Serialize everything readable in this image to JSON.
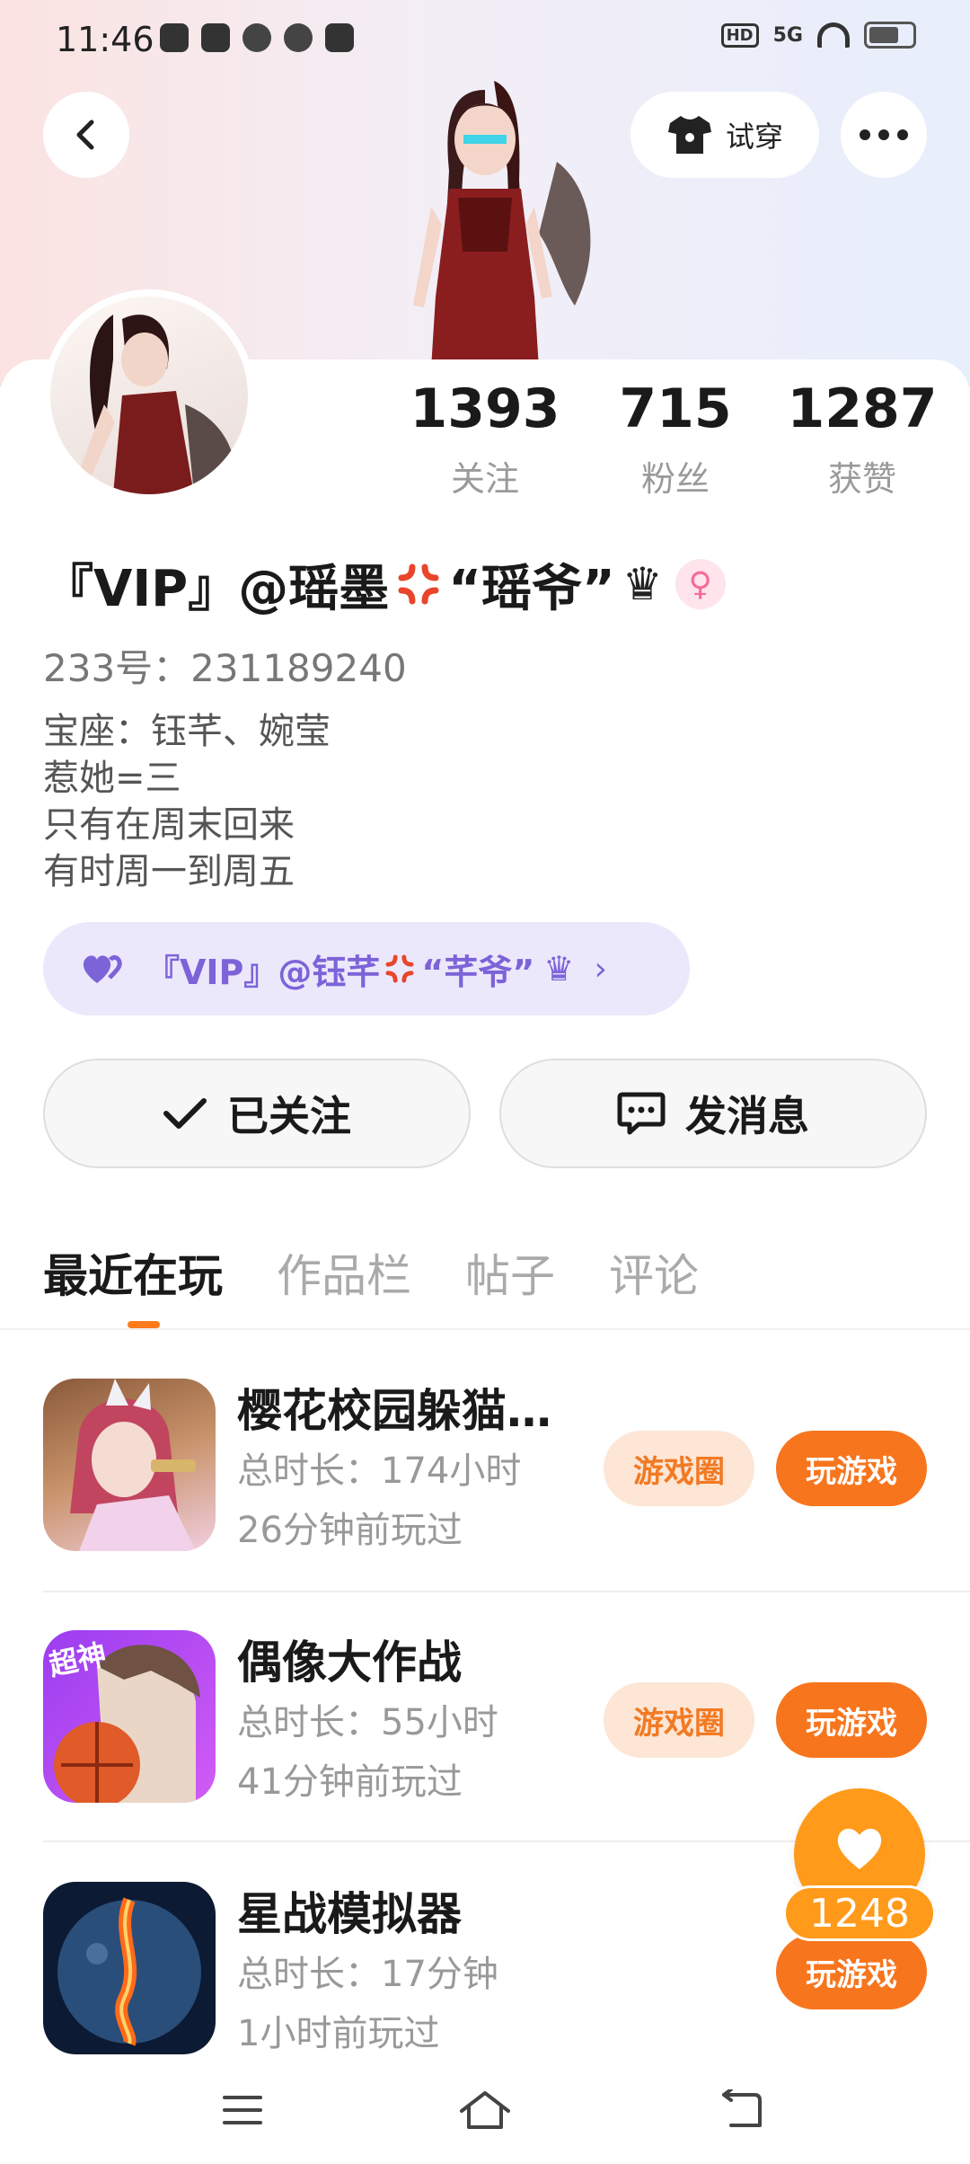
{
  "status_bar": {
    "time": "11:46",
    "hd_label": "HD",
    "network": "5G"
  },
  "header": {
    "tryon_label": "试穿"
  },
  "stats": [
    {
      "value": "1393",
      "label": "关注"
    },
    {
      "value": "715",
      "label": "粉丝"
    },
    {
      "value": "1287",
      "label": "获赞"
    }
  ],
  "profile": {
    "nickname_part1": "『VIP』@瑶墨",
    "nickname_part2": "“瑶爷”",
    "crown": "♛",
    "gender_symbol": "♀",
    "user_id": "233号：231189240",
    "bio": [
      "宝座：钰芊、婉莹",
      "惹她=三",
      "只有在周末回来",
      "有时周一到周五"
    ]
  },
  "linked_user": {
    "name_part1": "『VIP』@钰芊",
    "name_part2": "“芊爷”",
    "crown": "♛",
    "chevron": "›"
  },
  "actions": {
    "follow_label": "已关注",
    "message_label": "发消息"
  },
  "tabs": [
    "最近在玩",
    "作品栏",
    "帖子",
    "评论"
  ],
  "games": [
    {
      "title": "樱花校园躲猫…",
      "duration": "总时长：174小时",
      "last_played": "26分钟前玩过",
      "circle_label": "游戏圈",
      "play_label": "玩游戏"
    },
    {
      "title": "偶像大作战",
      "duration": "总时长：55小时",
      "last_played": "41分钟前玩过",
      "circle_label": "游戏圈",
      "play_label": "玩游戏",
      "icon_badge": "超神"
    },
    {
      "title": "星战模拟器",
      "duration": "总时长：17分钟",
      "last_played": "1小时前玩过",
      "play_label": "玩游戏"
    }
  ],
  "like_fab": {
    "count": "1248"
  },
  "colors": {
    "accent_orange": "#f7751d",
    "soft_orange": "#fde6d6",
    "linked_purple": "#7c63d8",
    "linked_bg": "#ebe8fb",
    "fab_orange": "#ff9a1a"
  }
}
